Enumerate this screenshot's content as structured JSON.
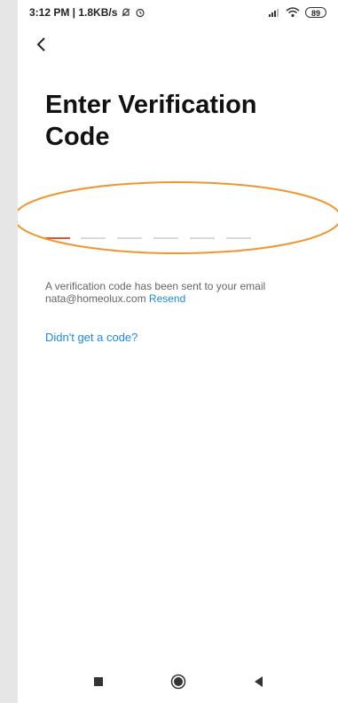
{
  "status": {
    "time_speed": "3:12 PM | 1.8KB/s",
    "battery": "89"
  },
  "page": {
    "title_line1": "Enter Verification",
    "title_line2": "Code"
  },
  "code": {
    "slot_count": 6,
    "value": ""
  },
  "info": {
    "message": "A verification code has been sent to your email",
    "email": "nata@homeolux.com",
    "resend_label": "Resend"
  },
  "help": {
    "no_code_label": "Didn't get a code?"
  },
  "colors": {
    "accent": "#e0552f",
    "link": "#1e88e5",
    "annotation": "#f0962f"
  },
  "icons": [
    "dnd-icon",
    "alarm-icon",
    "signal-icon",
    "wifi-icon",
    "battery-icon",
    "back-icon",
    "nav-recents-icon",
    "nav-home-icon",
    "nav-back-icon"
  ]
}
